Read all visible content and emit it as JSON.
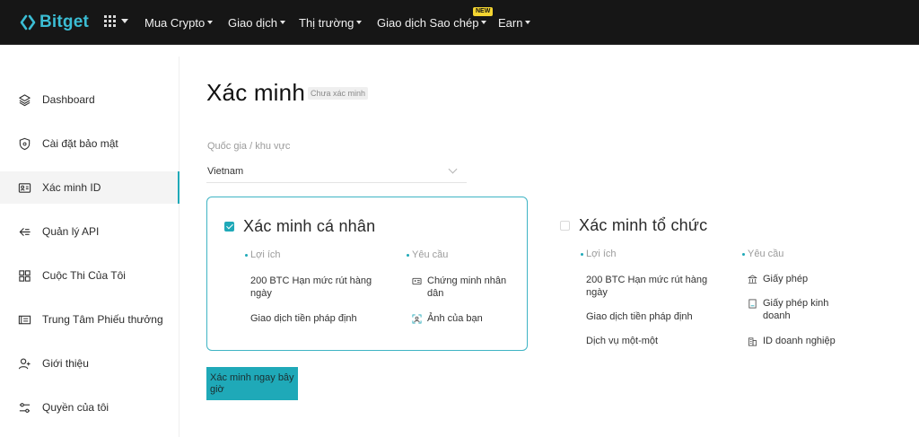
{
  "brand": {
    "name": "Bitget",
    "color": "#3bbdd4"
  },
  "nav": {
    "items": [
      {
        "label": "Mua Crypto"
      },
      {
        "label": "Giao dịch"
      },
      {
        "label": "Thị trường"
      },
      {
        "label": "Giao dịch Sao chép"
      },
      {
        "label": "Earn"
      }
    ],
    "new_badge": "NEW"
  },
  "sidebar": {
    "items": [
      {
        "label": "Dashboard",
        "icon": "layers-icon"
      },
      {
        "label": "Cài đặt bảo mật",
        "icon": "shield-icon"
      },
      {
        "label": "Xác minh ID",
        "icon": "id-card-icon",
        "active": true
      },
      {
        "label": "Quản lý API",
        "icon": "api-arrow-icon"
      },
      {
        "label": "Cuộc Thi Của Tôi",
        "icon": "grid-icon"
      },
      {
        "label": "Trung Tâm Phiếu thưởng",
        "icon": "coupon-icon"
      },
      {
        "label": "Giới thiệu",
        "icon": "user-add-icon"
      },
      {
        "label": "Quyền của tôi",
        "icon": "sliders-icon"
      }
    ]
  },
  "page": {
    "title": "Xác minh",
    "status": "Chưa xác minh"
  },
  "region": {
    "label": "Quốc gia / khu vực",
    "value": "Vietnam"
  },
  "personal": {
    "title": "Xác minh cá nhân",
    "checked": true,
    "benefits_label": "Lợi ích",
    "requirements_label": "Yêu cầu",
    "benefits": [
      "200 BTC Hạn mức rút hàng ngày",
      "Giao dịch tiền pháp định"
    ],
    "requirements": [
      {
        "label": "Chứng minh nhân dân",
        "icon": "id-document-icon"
      },
      {
        "label": "Ảnh của bạn",
        "icon": "selfie-icon"
      }
    ]
  },
  "organization": {
    "title": "Xác minh tổ chức",
    "checked": false,
    "benefits_label": "Lợi ích",
    "requirements_label": "Yêu cầu",
    "benefits": [
      "200 BTC Hạn mức rút hàng ngày",
      "Giao dịch tiền pháp định",
      "Dịch vụ một-một"
    ],
    "requirements": [
      {
        "label": "Giấy phép",
        "icon": "license-icon"
      },
      {
        "label": "Giấy phép kinh doanh",
        "icon": "business-license-icon"
      },
      {
        "label": "ID doanh nghiệp",
        "icon": "building-icon"
      }
    ]
  },
  "cta": {
    "label": "Xác minh ngay bây giờ"
  },
  "colors": {
    "accent": "#1fa9b8",
    "topbar": "#161616"
  }
}
